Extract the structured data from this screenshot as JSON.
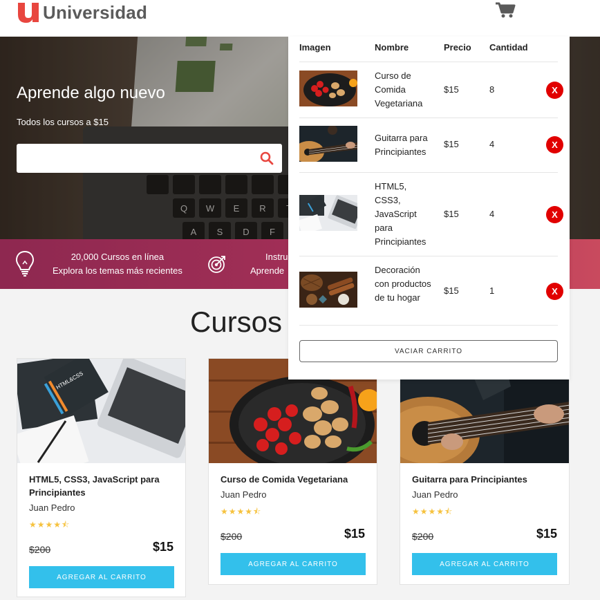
{
  "brand": {
    "name": "Universidad",
    "logo_letter": "u"
  },
  "colors": {
    "brand_red": "#e8463f",
    "accent_blue": "#33c0eb",
    "remove_red": "#e10000",
    "star": "#f6c23e"
  },
  "header": {
    "cart_icon": "shopping-cart-icon"
  },
  "hero": {
    "title": "Aprende algo nuevo",
    "subtitle": "Todos los cursos a $15",
    "search": {
      "value": "",
      "placeholder": ""
    }
  },
  "infobar": [
    {
      "icon": "lightbulb-icon",
      "line1": "20,000 Cursos en línea",
      "line2": "Explora los temas más recientes"
    },
    {
      "icon": "target-icon",
      "line1": "Instru",
      "line2": "Aprende"
    }
  ],
  "section": {
    "title": "Cursos I"
  },
  "courses": [
    {
      "title": "HTML5, CSS3, JavaScript para Principiantes",
      "author": "Juan Pedro",
      "rating": 4.5,
      "stars": "★★★★⯪",
      "old_price": "$200",
      "price": "$15",
      "button": "AGREGAR AL CARRITO"
    },
    {
      "title": "Curso de Comida Vegetariana",
      "author": "Juan Pedro",
      "rating": 4.5,
      "stars": "★★★★⯪",
      "old_price": "$200",
      "price": "$15",
      "button": "AGREGAR AL CARRITO"
    },
    {
      "title": "Guitarra para Principiantes",
      "author": "Juan Pedro",
      "rating": 4.5,
      "stars": "★★★★⯪",
      "old_price": "$200",
      "price": "$15",
      "button": "AGREGAR AL CARRITO"
    }
  ],
  "cart": {
    "headers": {
      "image": "Imagen",
      "name": "Nombre",
      "price": "Precio",
      "quantity": "Cantidad"
    },
    "items": [
      {
        "name": "Curso de Comida Vegetariana",
        "price": "$15",
        "quantity": "8",
        "remove": "X"
      },
      {
        "name": "Guitarra para Principiantes",
        "price": "$15",
        "quantity": "4",
        "remove": "X"
      },
      {
        "name": "HTML5, CSS3, JavaScript para Principiantes",
        "price": "$15",
        "quantity": "4",
        "remove": "X"
      },
      {
        "name": "Decoración con productos de tu hogar",
        "price": "$15",
        "quantity": "1",
        "remove": "X"
      }
    ],
    "empty_button": "VACIAR CARRITO"
  }
}
